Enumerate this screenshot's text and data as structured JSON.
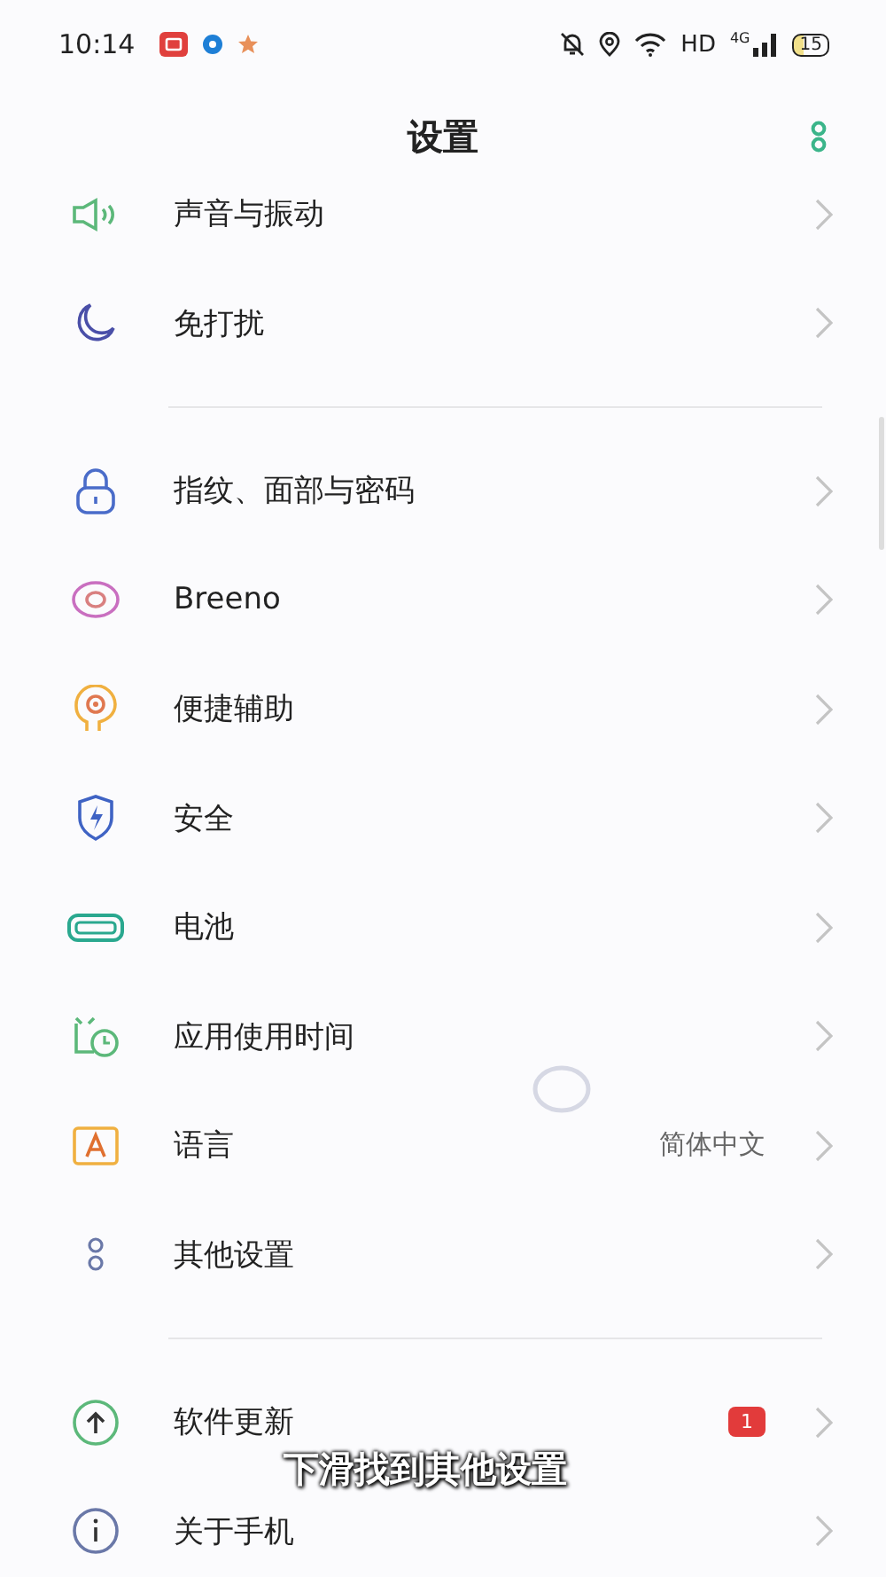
{
  "status_bar": {
    "time": "10:14",
    "network_label": "HD",
    "signal_label": "4G",
    "battery": "15"
  },
  "header": {
    "title": "设置"
  },
  "sections": [
    {
      "items": [
        {
          "label": "声音与振动"
        },
        {
          "label": "免打扰"
        }
      ]
    },
    {
      "items": [
        {
          "label": "指纹、面部与密码"
        },
        {
          "label": "Breeno"
        },
        {
          "label": "便捷辅助"
        },
        {
          "label": "安全"
        },
        {
          "label": "电池"
        },
        {
          "label": "应用使用时间"
        },
        {
          "label": "语言",
          "value": "简体中文"
        },
        {
          "label": "其他设置"
        }
      ]
    },
    {
      "items": [
        {
          "label": "软件更新",
          "badge": "1"
        },
        {
          "label": "关于手机"
        }
      ]
    }
  ],
  "caption": "下滑找到其他设置"
}
